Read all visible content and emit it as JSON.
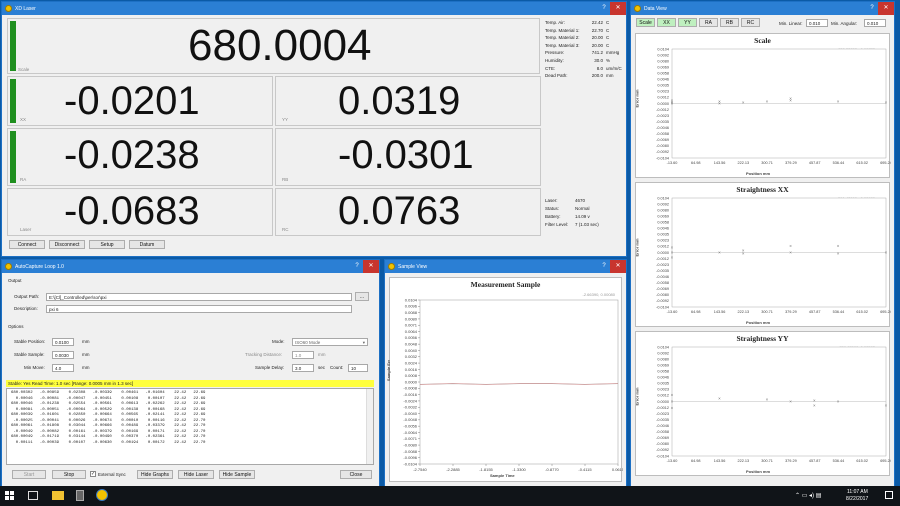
{
  "laser": {
    "title": "XD Laser",
    "scale_label": "Scale",
    "scale_value": "680.0004",
    "cells": [
      {
        "name": "XX",
        "value": "-0.0201"
      },
      {
        "name": "YY",
        "value": "0.0319"
      },
      {
        "name": "RA",
        "value": "-0.0238"
      },
      {
        "name": "RB",
        "value": "-0.0301"
      },
      {
        "name": "Laser",
        "value": "-0.0683"
      },
      {
        "name": "RC",
        "value": "0.0763"
      }
    ],
    "env": [
      {
        "label": "Temp. Air:",
        "value": "22.42",
        "unit": "C"
      },
      {
        "label": "Temp. Material 1:",
        "value": "22.70",
        "unit": "C"
      },
      {
        "label": "Temp. Material 2:",
        "value": "20.00",
        "unit": "C"
      },
      {
        "label": "Temp. Material 3:",
        "value": "20.00",
        "unit": "C"
      },
      {
        "label": "Pressure:",
        "value": "741.2",
        "unit": "mmHg"
      },
      {
        "label": "Humidity:",
        "value": "30.0",
        "unit": "%"
      },
      {
        "label": "CTE:",
        "value": "8.0",
        "unit": "um/m/C"
      },
      {
        "label": "Dead Path:",
        "value": "200.0",
        "unit": "mm"
      }
    ],
    "status": [
      {
        "label": "Laser:",
        "value": "4670"
      },
      {
        "label": "Status:",
        "value": "Normal"
      },
      {
        "label": "Battery:",
        "value": "14.09 v"
      },
      {
        "label": "Filter Level:",
        "value": "7 (1.03 sec)"
      }
    ],
    "buttons": [
      "Connect",
      "Disconnect",
      "Setup",
      "Datum"
    ]
  },
  "autocapture": {
    "title": "AutoCapture Loop 1.0",
    "output_label": "Output",
    "output_path_label": "Output Path:",
    "output_path": "E:\\[Cl]_Controlled\\per\\sor\\pxi",
    "description_label": "Description:",
    "description": "pxi 6",
    "browse": "...",
    "options_label": "Options",
    "stable_position_label": "Stable Position:",
    "stable_position": "0.0100",
    "stable_sample_label": "Stable Sample:",
    "stable_sample": "0.0030",
    "min_move_label": "Min Move:",
    "min_move": "4.0",
    "unit_mm": "mm",
    "mode_label": "Mode:",
    "mode": "ISO60 Mode",
    "tracking_label": "Tracking Distance:",
    "tracking": "1.0",
    "delay_label": "Sample Delay:",
    "delay": "3.0",
    "sec": "sec",
    "count_label": "Count:",
    "count": "10",
    "status_line": "Stable: Yes  Read Time: 1.0 sec  [Range: 0.0005 mm in 1.3 sec]",
    "rows": [
      "680.00302   -0.00859    0.02308   -0.00339    0.00461   -0.01604    22.42   22.69",
      "  0.00046   -0.00081   -0.00047   -0.00451    0.00108    0.00107    22.42   22.69",
      "680.00046   -0.01238    0.02554   -0.00561    0.00613   -0.02262    22.42   22.69",
      "  0.00081   -0.00051   -0.00064   -0.00529    0.00138    0.00168    22.42   22.69",
      "680.00039   -0.01601    0.02850   -0.00664    0.00565   -0.02141    22.42   22.69",
      " -0.00025   -0.00041    0.00026   -0.00674    0.00010    0.00116    22.42   22.70",
      "680.00061   -0.01808    0.03044   -0.00666    0.00489   -0.03379    22.42   22.70",
      " -0.00049   -0.00082    0.00161   -0.00379    0.00169    0.00171    22.42   22.70",
      "680.00049   -0.01719    0.03144   -0.00490    0.00370   -0.02361    22.42   22.70",
      "  0.00111   -0.00039    0.00107   -0.00630    0.00194    0.00172    22.42   22.70"
    ],
    "start": "Start",
    "stop": "Stop",
    "external_sync": "External Sync",
    "hide_graphs": "Hide Graphs",
    "hide_laser": "Hide Laser",
    "hide_sample": "Hide Sample",
    "close": "Close"
  },
  "sample": {
    "title": "Sample View",
    "chart_title": "Measurement Sample",
    "readout": "-2.66390,  0.00080",
    "ylabel": "Sample Err",
    "xlabel": "Sample Time",
    "yticks": [
      "0.0104",
      "0.0096",
      "0.0088",
      "0.0080",
      "0.0071",
      "0.0064",
      "0.0056",
      "0.0048",
      "0.0040",
      "0.0032",
      "0.0024",
      "0.0016",
      "0.0008",
      "0.0000",
      "-0.0008",
      "-0.0016",
      "-0.0024",
      "-0.0032",
      "-0.0040",
      "-0.0048",
      "-0.0056",
      "-0.0064",
      "-0.0071",
      "-0.0080",
      "-0.0088",
      "-0.0096",
      "-0.0104"
    ],
    "xticks": [
      "-2.7540",
      "-2.2885",
      "-1.8155",
      "-1.3300",
      "-0.8770",
      "-0.4115",
      "0.0615"
    ]
  },
  "dataview": {
    "title": "Data View",
    "tabs": [
      "Scale",
      "XX",
      "YY",
      "RA",
      "RB",
      "RC"
    ],
    "min_linear_label": "Min. Linear:",
    "min_linear": "0.010",
    "min_angular_label": "Min. Angular:",
    "min_angular": "0.010",
    "ylabel": "Error mm",
    "xlabel": "Position mm",
    "yticks": [
      "0.0104",
      "0.0092",
      "0.0080",
      "0.0069",
      "0.0058",
      "0.0046",
      "0.0035",
      "0.0023",
      "0.0012",
      "0.0000",
      "-0.0012",
      "-0.0023",
      "-0.0035",
      "-0.0046",
      "-0.0058",
      "-0.0069",
      "-0.0080",
      "-0.0092",
      "-0.0104"
    ],
    "xticks": [
      "-13.60",
      "64.98",
      "143.56",
      "222.13",
      "300.71",
      "379.29",
      "457.87",
      "536.44",
      "615.02",
      "695.24"
    ],
    "charts": [
      {
        "title": "Scale",
        "readout": "833.22222,  -0.00772"
      },
      {
        "title": "Straightness XX",
        "readout": "591.47660,  -0.00980"
      },
      {
        "title": "Straightness YY",
        "readout": "796.67690,  0.00583"
      }
    ]
  },
  "taskbar": {
    "time": "11:07 AM",
    "date": "8/22/2017"
  },
  "chart_data": [
    {
      "type": "line",
      "title": "Measurement Sample",
      "xlabel": "Sample Time",
      "ylabel": "Sample Err",
      "xlim": [
        -2.754,
        0.0615
      ],
      "ylim": [
        -0.0104,
        0.0104
      ],
      "series": [
        {
          "x": [
            -2.754,
            -2.2885,
            -1.8155,
            -1.33,
            -0.877,
            -0.4115,
            0.0615
          ],
          "y": [
            -0.0003,
            -0.0002,
            -0.0003,
            -0.0002,
            -0.0002,
            -0.0003,
            -0.0002
          ]
        }
      ]
    },
    {
      "type": "scatter",
      "title": "Scale",
      "xlabel": "Position mm",
      "ylabel": "Error mm",
      "xlim": [
        -13.6,
        695.24
      ],
      "ylim": [
        -0.0104,
        0.0104
      ],
      "series": [
        {
          "x": [
            -13.6,
            -13.6,
            -13.6,
            143.56,
            143.56,
            222.13,
            300.71,
            379.29,
            379.29,
            536.44,
            695.24
          ],
          "y": [
            0.0006,
            0.0002,
            0.0,
            0.0004,
            0.0,
            0.0002,
            0.0004,
            0.001,
            0.0006,
            0.0004,
            0.0002
          ]
        }
      ]
    },
    {
      "type": "scatter",
      "title": "Straightness XX",
      "xlabel": "Position mm",
      "ylabel": "Error mm",
      "xlim": [
        -13.6,
        695.24
      ],
      "ylim": [
        -0.0104,
        0.0104
      ],
      "series": [
        {
          "x": [
            -13.6,
            -13.6,
            -13.6,
            143.56,
            222.13,
            222.13,
            379.29,
            379.29,
            536.44,
            536.44,
            695.24
          ],
          "y": [
            0.001,
            0.0,
            -0.001,
            0.0,
            0.0004,
            -0.0002,
            0.0012,
            0.0,
            0.0012,
            -0.0002,
            0.0
          ]
        }
      ]
    },
    {
      "type": "scatter",
      "title": "Straightness YY",
      "xlabel": "Position mm",
      "ylabel": "Error mm",
      "xlim": [
        -13.6,
        695.24
      ],
      "ylim": [
        -0.0104,
        0.0104
      ],
      "series": [
        {
          "x": [
            -13.6,
            -13.6,
            -13.6,
            143.56,
            300.71,
            379.29,
            457.87,
            457.87,
            536.44,
            695.24
          ],
          "y": [
            0.0012,
            0.0,
            -0.0012,
            0.0006,
            0.0004,
            0.0,
            0.0002,
            -0.0008,
            0.0,
            -0.0008
          ]
        }
      ]
    }
  ]
}
